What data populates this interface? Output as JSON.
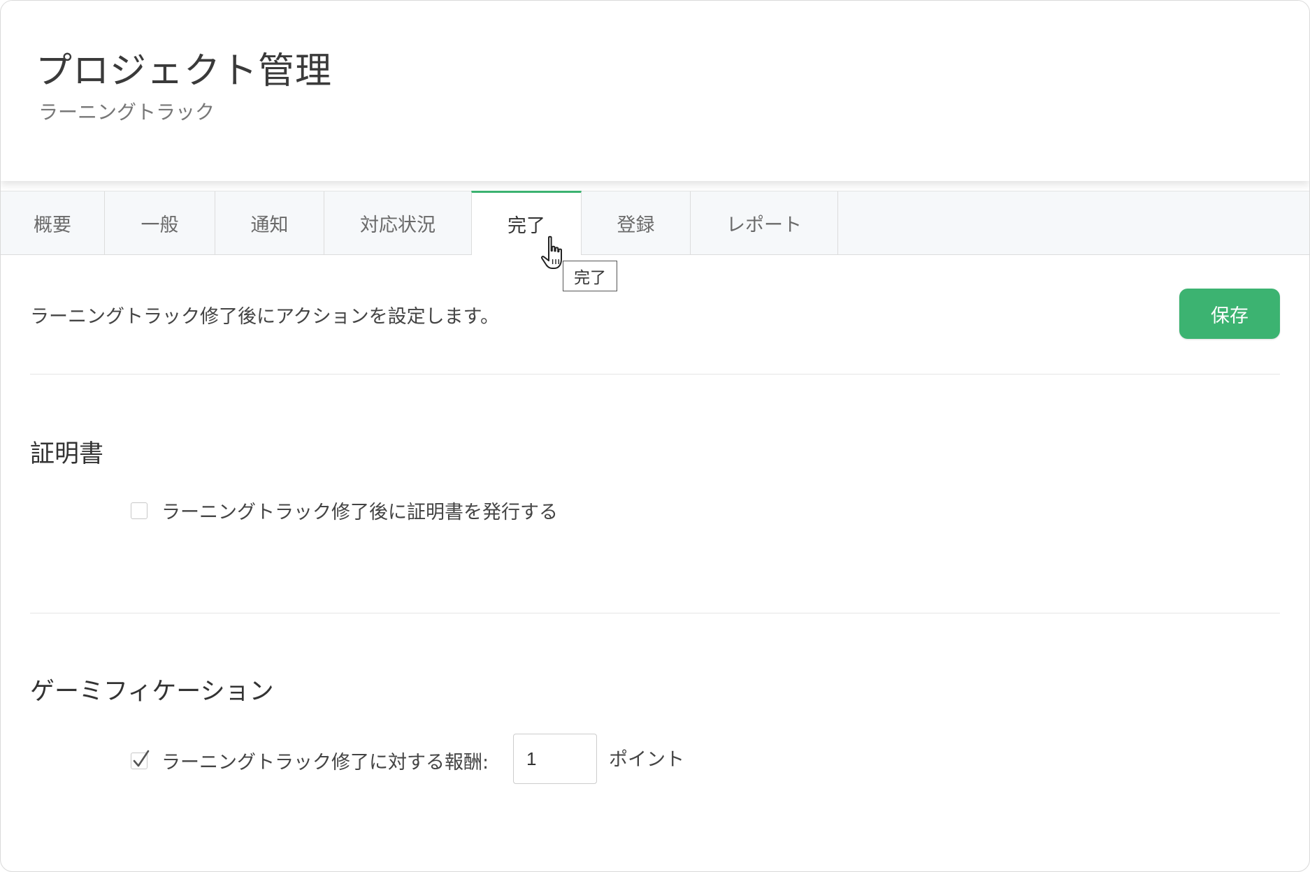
{
  "header": {
    "title": "プロジェクト管理",
    "subtitle": "ラーニングトラック"
  },
  "tabs": [
    {
      "label": "概要",
      "active": false
    },
    {
      "label": "一般",
      "active": false
    },
    {
      "label": "通知",
      "active": false
    },
    {
      "label": "対応状況",
      "active": false
    },
    {
      "label": "完了",
      "active": true
    },
    {
      "label": "登録",
      "active": false
    },
    {
      "label": "レポート",
      "active": false
    }
  ],
  "tooltip": "完了",
  "content": {
    "description": "ラーニングトラック修了後にアクションを設定します。",
    "save_label": "保存"
  },
  "certificate": {
    "heading": "証明書",
    "checkbox_label": "ラーニングトラック修了後に証明書を発行する",
    "checked": false
  },
  "gamification": {
    "heading": "ゲーミフィケーション",
    "checkbox_label": "ラーニングトラック修了に対する報酬:",
    "checked": true,
    "points_value": "1",
    "points_unit": "ポイント"
  },
  "colors": {
    "accent": "#3cb371",
    "tab_bar_bg": "#f6f8fa"
  }
}
